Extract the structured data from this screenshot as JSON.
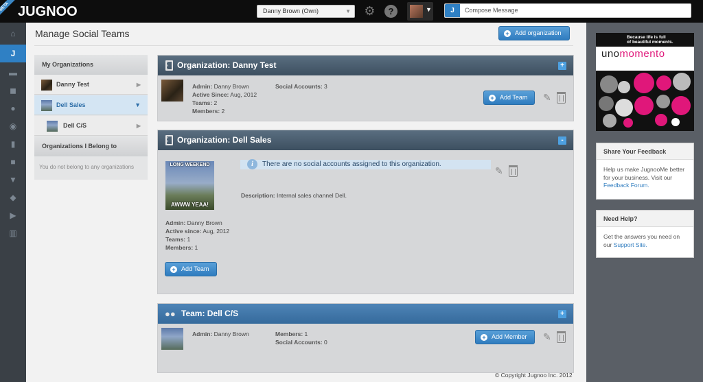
{
  "topbar": {
    "beta": "BETA",
    "logo": "JUGNOO",
    "account_selected": "Danny Brown (Own)",
    "compose_j": "J",
    "compose_placeholder": "Compose Message"
  },
  "leftnav": {
    "icons": [
      "home-icon",
      "jugnoo-icon",
      "chat-icon",
      "conversation-icon",
      "people-icon",
      "eye-icon",
      "document-icon",
      "video-icon",
      "trophy-icon",
      "tag-icon",
      "play-icon",
      "chart-icon"
    ],
    "active_label": "J"
  },
  "page": {
    "title": "Manage Social Teams",
    "add_org_label": "Add organization"
  },
  "subnav": {
    "my_orgs_head": "My Organizations",
    "items": [
      {
        "label": "Danny Test"
      },
      {
        "label": "Dell Sales"
      },
      {
        "label": "Dell C/S"
      }
    ],
    "belong_head": "Organizations I Belong to",
    "belong_empty": "You do not belong to any organizations"
  },
  "org_danny_test": {
    "title": "Organization: Danny Test",
    "toggle": "+",
    "admin_label": "Admin:",
    "admin": "Danny Brown",
    "active_label": "Active Since:",
    "active": "Aug, 2012",
    "teams_label": "Teams:",
    "teams": "2",
    "members_label": "Members:",
    "members": "2",
    "social_label": "Social Accounts:",
    "social": "3",
    "add_team_label": "Add Team"
  },
  "org_dell_sales": {
    "title": "Organization: Dell Sales",
    "toggle": "-",
    "info": "There are no social accounts assigned to this organization.",
    "description_label": "Description:",
    "description": "Internal sales channel Dell.",
    "meme_top": "LONG WEEKEND",
    "meme_bottom": "AWWW YEAA!",
    "admin_label": "Admin:",
    "admin": "Danny Brown",
    "active_label": "Active since:",
    "active": "Aug, 2012",
    "teams_label": "Teams:",
    "teams": "1",
    "members_label": "Members:",
    "members": "1",
    "add_team_label": "Add Team"
  },
  "team_dell_cs": {
    "title": "Team: Dell C/S",
    "toggle": "+",
    "admin_label": "Admin:",
    "admin": "Danny Brown",
    "members_label": "Members:",
    "members": "1",
    "social_label": "Social Accounts:",
    "social": "0",
    "add_member_label": "Add Member"
  },
  "rightcol": {
    "ad_tagline_1": "Because life is full",
    "ad_tagline_2": "of beautiful moments.",
    "ad_brand_a": "uno",
    "ad_brand_b": "momento",
    "feedback_head": "Share Your Feedback",
    "feedback_text": "Help us make JugnooMe better for your business. Visit our",
    "feedback_link": "Feedback Forum.",
    "help_head": "Need Help?",
    "help_text": "Get the answers you need on our",
    "help_link": "Support Site."
  },
  "footer": {
    "copyright": "© Copyright Jugnoo Inc. 2012"
  },
  "colors": {
    "accent": "#2f80c4",
    "topbar": "#0d0d0d",
    "leftnav": "#3a4046",
    "org_header": "#4a5e70",
    "team_header": "#3f77aa",
    "brand_pink": "#e0177a"
  }
}
